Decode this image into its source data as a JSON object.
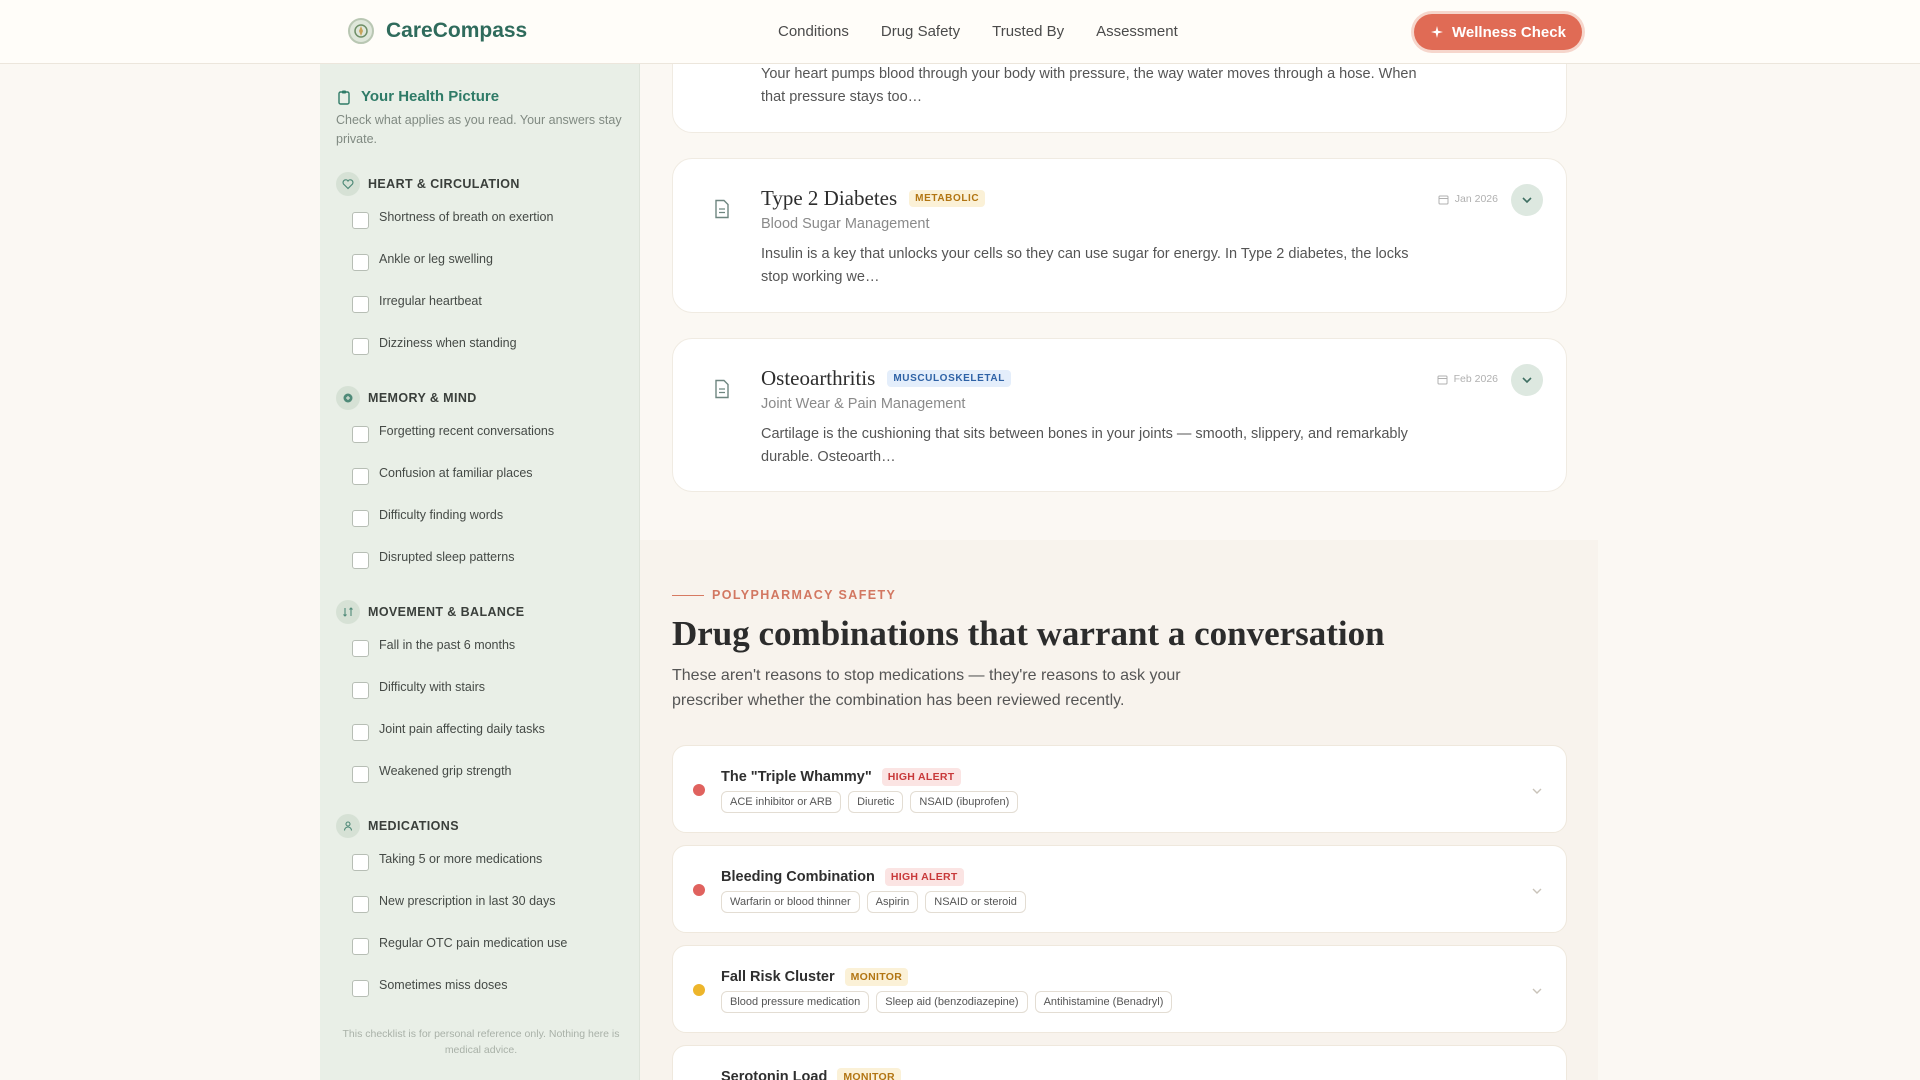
{
  "header": {
    "brand": "CareCompass",
    "nav": [
      "Conditions",
      "Drug Safety",
      "Trusted By",
      "Assessment"
    ],
    "cta_label": "Wellness Check"
  },
  "sidebar": {
    "title": "Your Health Picture",
    "subtitle": "Check what applies as you read. Your answers stay private.",
    "categories": [
      {
        "label": "HEART & CIRCULATION",
        "icon": "heart-icon",
        "items": [
          "Shortness of breath on exertion",
          "Ankle or leg swelling",
          "Irregular heartbeat",
          "Dizziness when standing"
        ]
      },
      {
        "label": "MEMORY & MIND",
        "icon": "brain-icon",
        "items": [
          "Forgetting recent conversations",
          "Confusion at familiar places",
          "Difficulty finding words",
          "Disrupted sleep patterns"
        ]
      },
      {
        "label": "MOVEMENT & BALANCE",
        "icon": "movement-icon",
        "items": [
          "Fall in the past 6 months",
          "Difficulty with stairs",
          "Joint pain affecting daily tasks",
          "Weakened grip strength"
        ]
      },
      {
        "label": "MEDICATIONS",
        "icon": "pill-icon",
        "items": [
          "Taking 5 or more medications",
          "New prescription in last 30 days",
          "Regular OTC pain medication use",
          "Sometimes miss doses"
        ]
      }
    ],
    "footer": "This checklist is for personal reference only. Nothing here is medical advice."
  },
  "conditions": [
    {
      "title": "",
      "tag": "",
      "subtitle": "",
      "description": "Your heart pumps blood through your body with pressure, the way water moves through a hose. When that pressure stays too…",
      "date": ""
    },
    {
      "title": "Type 2 Diabetes",
      "tag": "METABOLIC",
      "subtitle": "Blood Sugar Management",
      "description": "Insulin is a key that unlocks your cells so they can use sugar for energy. In Type 2 diabetes, the locks stop working we…",
      "date": "Jan 2026"
    },
    {
      "title": "Osteoarthritis",
      "tag": "MUSCULOSKELETAL",
      "subtitle": "Joint Wear & Pain Management",
      "description": "Cartilage is the cushioning that sits between bones in your joints — smooth, slippery, and remarkably durable. Osteoarth…",
      "date": "Feb 2026"
    }
  ],
  "polypharmacy": {
    "eyebrow": "POLYPHARMACY SAFETY",
    "heading": "Drug combinations that warrant a conversation",
    "intro": "These aren't reasons to stop medications — they're reasons to ask your prescriber whether the combination has been reviewed recently.",
    "colors": {
      "high": "#e0625e",
      "monitor": "#edb52b"
    },
    "risks": [
      {
        "title": "The \"Triple Whammy\"",
        "badge": "HIGH ALERT",
        "level": "high",
        "drugs": [
          "ACE inhibitor or ARB",
          "Diuretic",
          "NSAID (ibuprofen)"
        ]
      },
      {
        "title": "Bleeding Combination",
        "badge": "HIGH ALERT",
        "level": "high",
        "drugs": [
          "Warfarin or blood thinner",
          "Aspirin",
          "NSAID or steroid"
        ]
      },
      {
        "title": "Fall Risk Cluster",
        "badge": "MONITOR",
        "level": "monitor",
        "drugs": [
          "Blood pressure medication",
          "Sleep aid (benzodiazepine)",
          "Antihistamine (Benadryl)"
        ]
      },
      {
        "title": "Serotonin Load",
        "badge": "MONITOR",
        "level": "monitor",
        "drugs": []
      }
    ]
  }
}
